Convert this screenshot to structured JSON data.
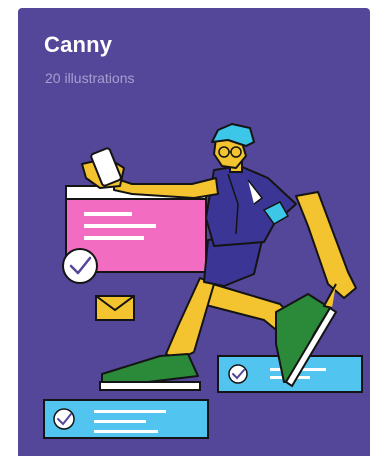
{
  "pack": {
    "title": "Canny",
    "subtitle": "20 illustrations"
  },
  "colors": {
    "card_background": "#54479a",
    "subtitle": "#a69fcf",
    "skin": "#f3c42f",
    "outfit": "#3b3696",
    "shoes": "#2a8a3a",
    "hair": "#3cc6e8",
    "pink_panel": "#f26cc2",
    "blue_panel": "#52c4f0",
    "envelope": "#f3c42f",
    "outline": "#141414"
  },
  "icons": [
    "smartphone-icon",
    "checkmark-icon",
    "envelope-icon"
  ]
}
